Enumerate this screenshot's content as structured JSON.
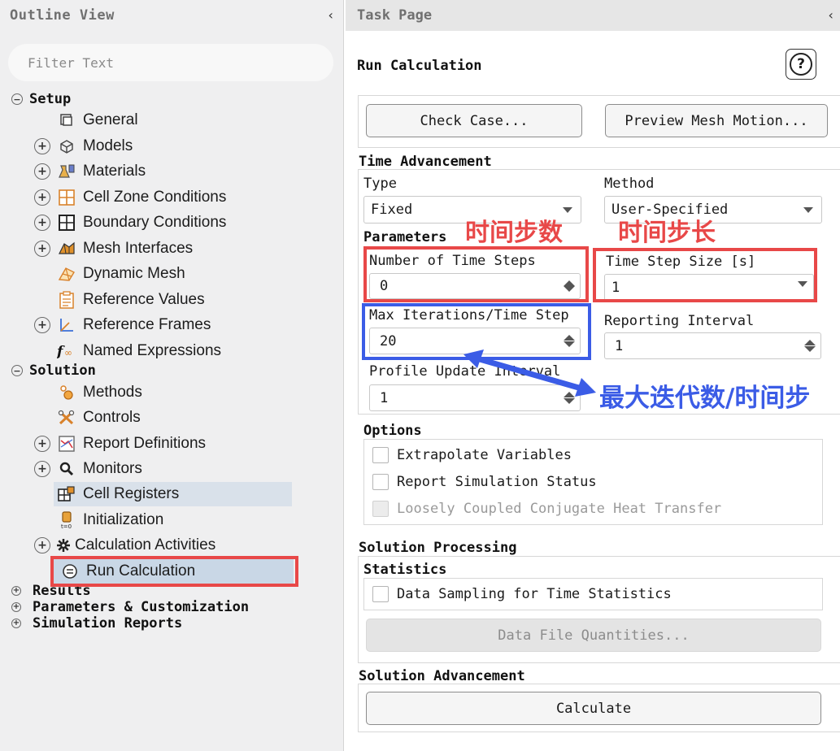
{
  "outline": {
    "title": "Outline View",
    "collapse_glyph": "‹",
    "filter_placeholder": "Filter Text",
    "items": [
      {
        "label": "Setup",
        "expander": "−"
      },
      {
        "label": "General"
      },
      {
        "label": "Models",
        "expander": "+"
      },
      {
        "label": "Materials",
        "expander": "+"
      },
      {
        "label": "Cell Zone Conditions",
        "expander": "+"
      },
      {
        "label": "Boundary Conditions",
        "expander": "+"
      },
      {
        "label": "Mesh Interfaces",
        "expander": "+"
      },
      {
        "label": "Dynamic Mesh"
      },
      {
        "label": "Reference Values"
      },
      {
        "label": "Reference Frames",
        "expander": "+"
      },
      {
        "label": "Named Expressions"
      },
      {
        "label": "Solution",
        "expander": "−"
      },
      {
        "label": "Methods"
      },
      {
        "label": "Controls"
      },
      {
        "label": "Report Definitions",
        "expander": "+"
      },
      {
        "label": "Monitors",
        "expander": "+"
      },
      {
        "label": "Cell Registers"
      },
      {
        "label": "Initialization"
      },
      {
        "label": "Calculation Activities",
        "expander": "+"
      },
      {
        "label": "Run Calculation"
      },
      {
        "label": "Results",
        "expander": "+"
      },
      {
        "label": "Parameters & Customization",
        "expander": "+"
      },
      {
        "label": "Simulation Reports",
        "expander": "+"
      }
    ]
  },
  "task": {
    "title": "Task Page",
    "collapse_glyph": "‹",
    "heading": "Run Calculation",
    "help_glyph": "?",
    "check_case": "Check Case...",
    "preview_mesh": "Preview Mesh Motion...",
    "time_advancement": {
      "title": "Time Advancement",
      "type_label": "Type",
      "type_value": "Fixed",
      "method_label": "Method",
      "method_value": "User-Specified"
    },
    "parameters": {
      "title": "Parameters",
      "num_steps_label": "Number of Time Steps",
      "num_steps_value": "0",
      "step_size_label": "Time Step Size [s]",
      "step_size_value": "1",
      "max_iter_label": "Max Iterations/Time Step",
      "max_iter_value": "20",
      "report_interval_label": "Reporting Interval",
      "report_interval_value": "1",
      "profile_label": "Profile Update Interval",
      "profile_value": "1"
    },
    "options": {
      "title": "Options",
      "extrapolate": "Extrapolate Variables",
      "report_status": "Report Simulation Status",
      "loosely_coupled": "Loosely Coupled Conjugate Heat Transfer"
    },
    "solution_processing": {
      "title": "Solution Processing",
      "statistics_title": "Statistics",
      "data_sampling": "Data Sampling for Time Statistics",
      "data_file_quantities": "Data File Quantities..."
    },
    "solution_advancement": {
      "title": "Solution Advancement",
      "calculate": "Calculate"
    }
  },
  "annotations": {
    "num_steps": "时间步数",
    "step_size": "时间步长",
    "max_iter": "最大迭代数/时间步"
  },
  "colors": {
    "annotation_red": "#e84848",
    "annotation_blue": "#3b5ce6",
    "selection": "#c9d7e6"
  }
}
